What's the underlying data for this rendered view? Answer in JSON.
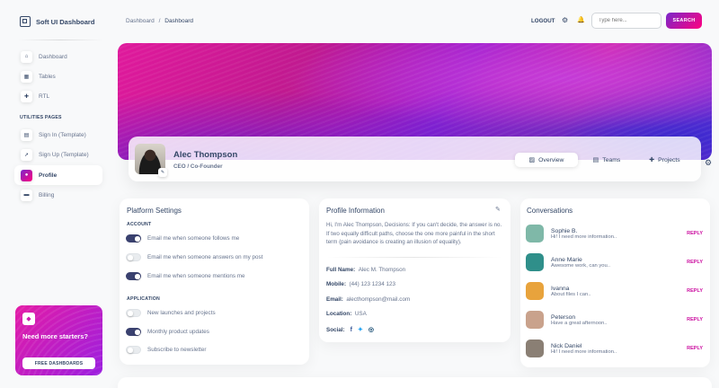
{
  "brand": {
    "name": "Soft UI Dashboard",
    "icon": "logo-icon"
  },
  "sidebar": {
    "items": [
      {
        "label": "Dashboard",
        "icon": "home-icon"
      },
      {
        "label": "Tables",
        "icon": "table-icon"
      },
      {
        "label": "RTL",
        "icon": "tool-icon"
      }
    ],
    "section_label": "UTILITIES PAGES",
    "utility_items": [
      {
        "label": "Sign In (Template)",
        "icon": "document-icon"
      },
      {
        "label": "Sign Up (Template)",
        "icon": "rocket-icon"
      },
      {
        "label": "Profile",
        "icon": "user-icon",
        "active": true
      },
      {
        "label": "Billing",
        "icon": "credit-card-icon"
      }
    ],
    "help_card": {
      "title": "Need more starters?",
      "button": "FREE DASHBOARDS",
      "icon": "diamond-icon"
    }
  },
  "navbar": {
    "breadcrumb_root": "Dashboard",
    "breadcrumb_sep": "/",
    "breadcrumb_current": "Dashboard",
    "logout": "LOGOUT",
    "search_placeholder": "Type here...",
    "search_button": "SEARCH"
  },
  "profile": {
    "name": "Alec Thompson",
    "role": "CEO / Co-Founder",
    "tabs": [
      {
        "label": "Overview",
        "icon": "cube-icon",
        "active": true
      },
      {
        "label": "Teams",
        "icon": "document-icon"
      },
      {
        "label": "Projects",
        "icon": "tools-icon"
      }
    ]
  },
  "platform_settings": {
    "title": "Platform Settings",
    "account_label": "ACCOUNT",
    "account": [
      {
        "label": "Email me when someone follows me",
        "on": true
      },
      {
        "label": "Email me when someone answers on my post",
        "on": false
      },
      {
        "label": "Email me when someone mentions me",
        "on": true
      }
    ],
    "application_label": "APPLICATION",
    "application": [
      {
        "label": "New launches and projects",
        "on": false
      },
      {
        "label": "Monthly product updates",
        "on": true
      },
      {
        "label": "Subscribe to newsletter",
        "on": false
      }
    ]
  },
  "profile_info": {
    "title": "Profile Information",
    "bio": "Hi, I'm Alec Thompson, Decisions: If you can't decide, the answer is no. If two equally difficult paths, choose the one more painful in the short term (pain avoidance is creating an illusion of equality).",
    "fields": [
      {
        "label": "Full Name:",
        "value": "Alec M. Thompson"
      },
      {
        "label": "Mobile:",
        "value": "(44) 123 1234 123"
      },
      {
        "label": "Email:",
        "value": "alecthompson@mail.com"
      },
      {
        "label": "Location:",
        "value": "USA"
      }
    ],
    "social_label": "Social:",
    "socials": [
      "facebook-icon",
      "twitter-icon",
      "instagram-icon"
    ]
  },
  "conversations": {
    "title": "Conversations",
    "reply_label": "REPLY",
    "items": [
      {
        "name": "Sophie B.",
        "message": "Hi! I need more information..",
        "color": "#7fb8a8"
      },
      {
        "name": "Anne Marie",
        "message": "Awesome work, can you..",
        "color": "#2f8f8a"
      },
      {
        "name": "Ivanna",
        "message": "About files I can..",
        "color": "#e8a33c"
      },
      {
        "name": "Peterson",
        "message": "Have a great afternoon..",
        "color": "#c9a28c"
      },
      {
        "name": "Nick Daniel",
        "message": "Hi! I need more information..",
        "color": "#8a7f74"
      }
    ]
  },
  "colors": {
    "accent": "#cb0c9f",
    "gradient_start": "#7928ca",
    "gradient_end": "#ff0080",
    "text": "#344767"
  }
}
